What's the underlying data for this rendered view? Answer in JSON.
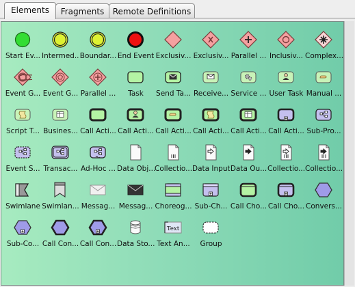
{
  "tabs": [
    {
      "label": "Elements",
      "active": true
    },
    {
      "label": "Fragments",
      "active": false
    },
    {
      "label": "Remote Definitions",
      "active": false
    }
  ],
  "palette": {
    "items": [
      {
        "label": "Start Ev...",
        "icon": "start-event"
      },
      {
        "label": "Intermed...",
        "icon": "intermediate-event"
      },
      {
        "label": "Boundar...",
        "icon": "boundary-event"
      },
      {
        "label": "End Event",
        "icon": "end-event"
      },
      {
        "label": "Exclusiv...",
        "icon": "exclusive-gateway"
      },
      {
        "label": "Exclusiv...",
        "icon": "exclusive-gateway-x"
      },
      {
        "label": "Parallel ...",
        "icon": "parallel-gateway"
      },
      {
        "label": "Inclusiv...",
        "icon": "inclusive-gateway"
      },
      {
        "label": "Complex...",
        "icon": "complex-gateway"
      },
      {
        "label": "Event G...",
        "icon": "event-gateway"
      },
      {
        "label": "Event G...",
        "icon": "event-gateway-2"
      },
      {
        "label": "Parallel ...",
        "icon": "parallel-event-gateway"
      },
      {
        "label": "Task",
        "icon": "task"
      },
      {
        "label": "Send Ta...",
        "icon": "send-task"
      },
      {
        "label": "Receive...",
        "icon": "receive-task"
      },
      {
        "label": "Service ...",
        "icon": "service-task"
      },
      {
        "label": "User Task",
        "icon": "user-task"
      },
      {
        "label": "Manual ...",
        "icon": "manual-task"
      },
      {
        "label": "Script T...",
        "icon": "script-task"
      },
      {
        "label": "Busines...",
        "icon": "business-rule-task"
      },
      {
        "label": "Call Acti...",
        "icon": "call-activity"
      },
      {
        "label": "Call Acti...",
        "icon": "call-activity-user"
      },
      {
        "label": "Call Acti...",
        "icon": "call-activity-manual"
      },
      {
        "label": "Call Acti...",
        "icon": "call-activity-script"
      },
      {
        "label": "Call Acti...",
        "icon": "call-activity-rule"
      },
      {
        "label": "Call Acti...",
        "icon": "call-activity-collapsed"
      },
      {
        "label": "Sub-Pro...",
        "icon": "sub-process"
      },
      {
        "label": "Event S...",
        "icon": "event-subprocess"
      },
      {
        "label": "Transac...",
        "icon": "transaction"
      },
      {
        "label": "Ad-Hoc ...",
        "icon": "adhoc-subprocess"
      },
      {
        "label": "Data Obj...",
        "icon": "data-object"
      },
      {
        "label": "Collectio...",
        "icon": "data-collection"
      },
      {
        "label": "Data Input",
        "icon": "data-input"
      },
      {
        "label": "Data Ou...",
        "icon": "data-output"
      },
      {
        "label": "Collectio...",
        "icon": "data-input-collection"
      },
      {
        "label": "Collectio...",
        "icon": "data-output-collection"
      },
      {
        "label": "Swimlane",
        "icon": "swimlane"
      },
      {
        "label": "Swimlan...",
        "icon": "swimlane-2"
      },
      {
        "label": "Messag...",
        "icon": "message"
      },
      {
        "label": "Messag...",
        "icon": "message-dark"
      },
      {
        "label": "Choreog...",
        "icon": "choreography"
      },
      {
        "label": "Sub-Ch...",
        "icon": "sub-choreography"
      },
      {
        "label": "Call Cho...",
        "icon": "call-choreography"
      },
      {
        "label": "Call Cho...",
        "icon": "call-choreography-2"
      },
      {
        "label": "Convers...",
        "icon": "conversation"
      },
      {
        "label": "Sub-Co...",
        "icon": "sub-conversation"
      },
      {
        "label": "Call Con...",
        "icon": "call-conversation"
      },
      {
        "label": "Call Con...",
        "icon": "call-conversation-2"
      },
      {
        "label": "Data Sto...",
        "icon": "data-store"
      },
      {
        "label": "Text An...",
        "icon": "text-annotation"
      },
      {
        "label": "Group",
        "icon": "group"
      }
    ],
    "text_annotation_glyph": "Text"
  }
}
